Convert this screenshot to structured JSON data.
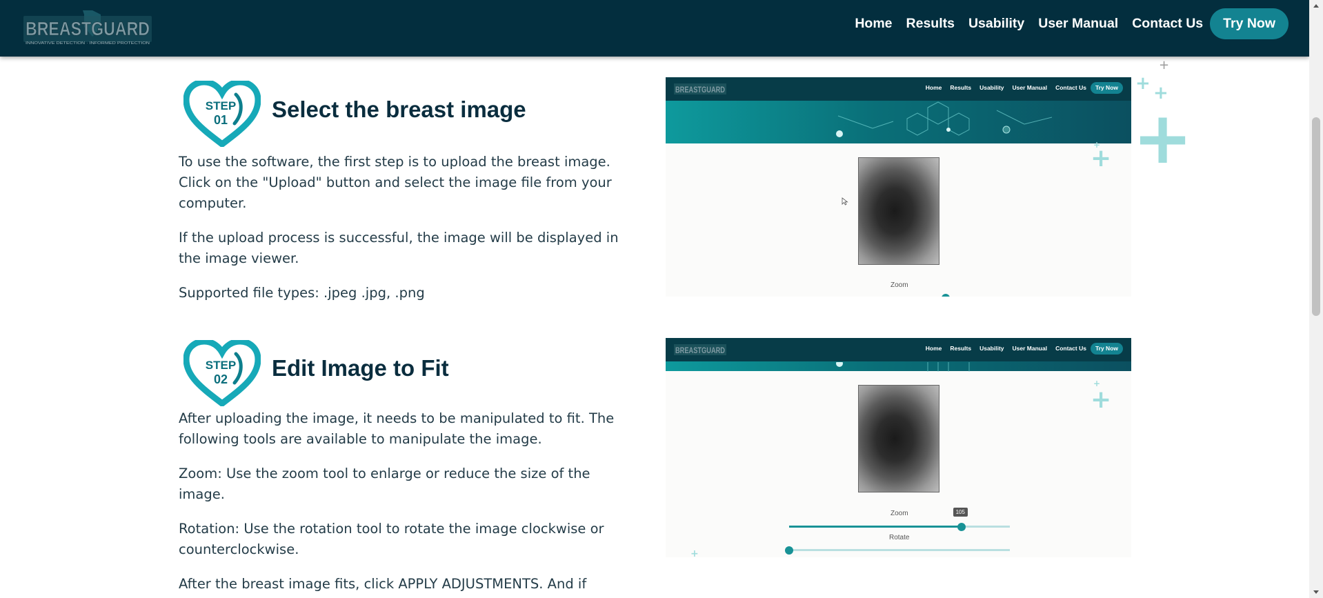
{
  "header": {
    "logo_text": "BREASTGUARD",
    "logo_tagline": "INNOVATIVE DETECTION · INFORMED PROTECTION",
    "nav": [
      "Home",
      "Results",
      "Usability",
      "User Manual",
      "Contact Us"
    ],
    "cta": "Try Now"
  },
  "steps": [
    {
      "badge_word": "STEP",
      "badge_num": "01",
      "title": "Select the breast image",
      "paragraphs": [
        "To use the software, the first step is to upload the breast image. Click on the \"Upload\" button and select the image file from your computer.",
        "If the upload process is successful, the image will be displayed in the image viewer.",
        "Supported file types: .jpeg .jpg, .png"
      ]
    },
    {
      "badge_word": "STEP",
      "badge_num": "02",
      "title": "Edit Image to Fit",
      "paragraphs": [
        "After uploading the image, it needs to be manipulated to fit. The following tools are available to manipulate the image.",
        "Zoom: Use the zoom tool to enlarge or reduce the size of the image.",
        "Rotation: Use the rotation tool to rotate the image clockwise or counterclockwise.",
        "After the breast image fits, click APPLY ADJUSTMENTS. And if"
      ]
    }
  ],
  "mockup": {
    "nav": [
      "Home",
      "Results",
      "Usability",
      "User Manual",
      "Contact Us"
    ],
    "cta": "Try Now",
    "zoom_label": "Zoom",
    "rotate_label": "Rotate",
    "zoom_value": "105",
    "zoom_fraction": 0.78,
    "rotate_fraction": 0.0
  },
  "colors": {
    "header_bg": "#032e3e",
    "accent": "#138391",
    "heart_teal": "#16a9b8"
  }
}
